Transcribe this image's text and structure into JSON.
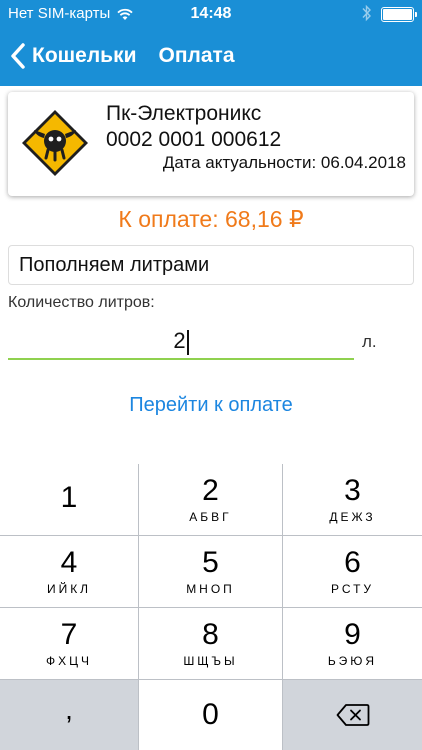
{
  "status_bar": {
    "carrier": "Нет SIM-карты",
    "time": "14:48",
    "wifi_icon": "wifi-icon",
    "bluetooth_icon": "bluetooth-icon",
    "battery_icon": "battery-icon"
  },
  "nav": {
    "back_label": "Кошельки",
    "title": "Оплата"
  },
  "card": {
    "name": "Пк-Электроникс",
    "number": "0002 0001 000612",
    "date": "Дата актуальности: 06.04.2018",
    "logo": "merchant-logo"
  },
  "amount": "К оплате: 68,16 ₽",
  "mode": "Пополняем литрами",
  "liters": {
    "label": "Количество литров:",
    "value": "2",
    "unit": "л."
  },
  "pay_button": "Перейти к оплате",
  "keypad": {
    "keys": [
      {
        "digit": "1",
        "letters": ""
      },
      {
        "digit": "2",
        "letters": "АБВГ"
      },
      {
        "digit": "3",
        "letters": "ДЕЖЗ"
      },
      {
        "digit": "4",
        "letters": "ИЙКЛ"
      },
      {
        "digit": "5",
        "letters": "МНОП"
      },
      {
        "digit": "6",
        "letters": "РСТУ"
      },
      {
        "digit": "7",
        "letters": "ФХЦЧ"
      },
      {
        "digit": "8",
        "letters": "ШЩЪЫ"
      },
      {
        "digit": "9",
        "letters": "ЬЭЮЯ"
      }
    ],
    "comma": ",",
    "zero": "0",
    "backspace_icon": "backspace-icon"
  },
  "colors": {
    "header": "#1a8fd6",
    "amount": "#f07a1a",
    "link": "#1c86e0",
    "input_underline": "#8fd14f"
  }
}
